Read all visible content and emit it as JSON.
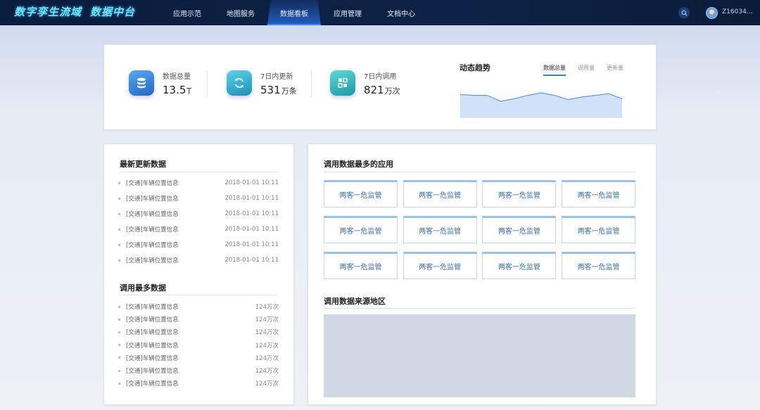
{
  "header": {
    "brand_part1": "数字孪生流域",
    "brand_part2": "数据中台",
    "nav": [
      {
        "label": "应用示范",
        "active": false
      },
      {
        "label": "地图服务",
        "active": false
      },
      {
        "label": "数据看板",
        "active": true
      },
      {
        "label": "应用管理",
        "active": false
      },
      {
        "label": "文档中心",
        "active": false
      }
    ],
    "search_icon": "search-icon",
    "username": "Z16034..."
  },
  "stats": [
    {
      "label": "数据总量",
      "value": "13.5",
      "unit": "T",
      "icon": "database-icon"
    },
    {
      "label": "7日内更新",
      "value": "531",
      "unit": "万条",
      "icon": "refresh-icon"
    },
    {
      "label": "7日内调用",
      "value": "821",
      "unit": "万次",
      "icon": "data-call-icon"
    }
  ],
  "trend": {
    "title": "动态趋势",
    "tabs": [
      {
        "label": "数据总量",
        "active": true
      },
      {
        "label": "调用量",
        "active": false
      },
      {
        "label": "更新量",
        "active": false
      }
    ],
    "chart_data": {
      "type": "area",
      "values": [
        28,
        27,
        27,
        20,
        23,
        27,
        30,
        27,
        22,
        25,
        27,
        29,
        23
      ],
      "ylim": [
        0,
        40
      ],
      "color": "#5b9af0",
      "fill": "#c8dcf7"
    }
  },
  "latest": {
    "title": "最新更新数据",
    "items": [
      {
        "name": "[交通]车辆位置信息",
        "time": "2018-01-01 10:11"
      },
      {
        "name": "[交通]车辆位置信息",
        "time": "2018-01-01 10:11"
      },
      {
        "name": "[交通]车辆位置信息",
        "time": "2018-01-01 10:11"
      },
      {
        "name": "[交通]车辆位置信息",
        "time": "2018-01-01 10:11"
      },
      {
        "name": "[交通]车辆位置信息",
        "time": "2018-01-01 10:11"
      },
      {
        "name": "[交通]车辆位置信息",
        "time": "2018-01-01 10:11"
      }
    ]
  },
  "most_called": {
    "title": "调用最多数据",
    "items": [
      {
        "name": "[交通]车辆位置信息",
        "count": "124万次"
      },
      {
        "name": "[交通]车辆位置信息",
        "count": "124万次"
      },
      {
        "name": "[交通]车辆位置信息",
        "count": "124万次"
      },
      {
        "name": "[交通]车辆位置信息",
        "count": "124万次"
      },
      {
        "name": "[交通]车辆位置信息",
        "count": "124万次"
      },
      {
        "name": "[交通]车辆位置信息",
        "count": "124万次"
      },
      {
        "name": "[交通]车辆位置信息",
        "count": "124万次"
      }
    ]
  },
  "apps": {
    "title": "调用数据最多的应用",
    "items": [
      "两客一危监管",
      "两客一危监管",
      "两客一危监管",
      "两客一危监管",
      "两客一危监管",
      "两客一危监管",
      "两客一危监管",
      "两客一危监管",
      "两客一危监管",
      "两客一危监管",
      "两客一危监管",
      "两客一危监管"
    ]
  },
  "region": {
    "title": "调用数据来源地区"
  }
}
